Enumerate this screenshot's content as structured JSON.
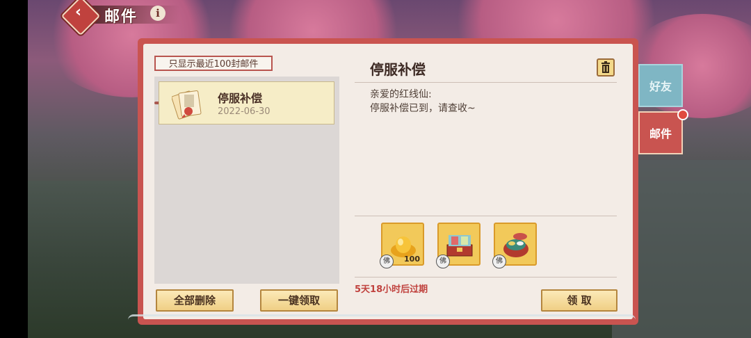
{
  "header": {
    "title": "邮件",
    "info_glyph": "i",
    "back_icon": "back-arrow-icon"
  },
  "mailbox": {
    "filter_label": "只显示最近100封邮件",
    "items": [
      {
        "title": "停服补偿",
        "date": "2022-06-30",
        "icon": "mail-envelope-icon",
        "selected": true
      }
    ],
    "delete_all_label": "全部删除",
    "claim_all_label": "一键领取"
  },
  "detail": {
    "title": "停服补偿",
    "greeting": "亲爱的红线仙:",
    "body": "停服补偿已到，请查收~",
    "rewards": [
      {
        "icon": "gold-ingot-icon",
        "count": "100",
        "badge": "佛"
      },
      {
        "icon": "treasure-chest-icon",
        "count": "",
        "badge": "佛"
      },
      {
        "icon": "gift-box-icon",
        "count": "",
        "badge": "佛"
      }
    ],
    "expire_text": "5天18小时后过期",
    "claim_label": "领 取"
  },
  "tabs": [
    {
      "label": "好友",
      "active": false
    },
    {
      "label": "邮件",
      "active": true
    }
  ],
  "colors": {
    "panel_red": "#c95450",
    "gold": "#f2c95a",
    "tab_teal": "#7fb6c4",
    "expire_red": "#c0423e"
  }
}
